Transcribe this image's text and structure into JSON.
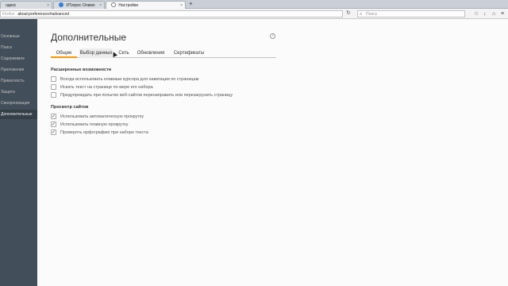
{
  "tabs": [
    {
      "title": "ндекс",
      "active": false
    },
    {
      "title": "ИТигрес Олимп",
      "active": false
    },
    {
      "title": "Настройки",
      "active": true
    }
  ],
  "new_tab": "+",
  "urlbar": {
    "brand": "Firefox",
    "address": "about:preferences#advanced"
  },
  "search": {
    "placeholder": "Поиск"
  },
  "sidebar": {
    "items": [
      {
        "label": "Основные",
        "selected": false
      },
      {
        "label": "Поиск",
        "selected": false
      },
      {
        "label": "Содержимое",
        "selected": false
      },
      {
        "label": "Приложения",
        "selected": false
      },
      {
        "label": "Приватность",
        "selected": false
      },
      {
        "label": "Защита",
        "selected": false
      },
      {
        "label": "Синхронизация",
        "selected": false
      },
      {
        "label": "Дополнительные",
        "selected": true
      }
    ]
  },
  "page": {
    "title": "Дополнительные",
    "help": "?"
  },
  "subtabs": [
    {
      "label": "Общие",
      "active": true
    },
    {
      "label": "Выбор данных",
      "active": false
    },
    {
      "label": "Сеть",
      "active": false
    },
    {
      "label": "Обновления",
      "active": false
    },
    {
      "label": "Сертификаты",
      "active": false
    }
  ],
  "sections": [
    {
      "title": "Расширенные возможности",
      "options": [
        {
          "label": "Всегда использовать клавиши курсора для навигации по страницам",
          "checked": false
        },
        {
          "label": "Искать текст на странице по мере его набора",
          "checked": false
        },
        {
          "label": "Предупреждать при попытке веб-сайтов перенаправить или перезагрузить страницу",
          "checked": false
        }
      ]
    },
    {
      "title": "Просмотр сайтов",
      "options": [
        {
          "label": "Использовать автоматическую прокрутку",
          "checked": true
        },
        {
          "label": "Использовать плавную прокрутку",
          "checked": true
        },
        {
          "label": "Проверять орфографию при наборе текста",
          "checked": true
        }
      ]
    }
  ],
  "icons": {
    "check": "✓",
    "close": "×",
    "reload": "↻",
    "search": "⌕",
    "star": "☆",
    "downloads": "↓",
    "home": "⌂",
    "menu": "≡"
  },
  "colors": {
    "sidebar": "#424f5a",
    "sidebar_selected": "#343f48",
    "accent": "#ff9500"
  }
}
